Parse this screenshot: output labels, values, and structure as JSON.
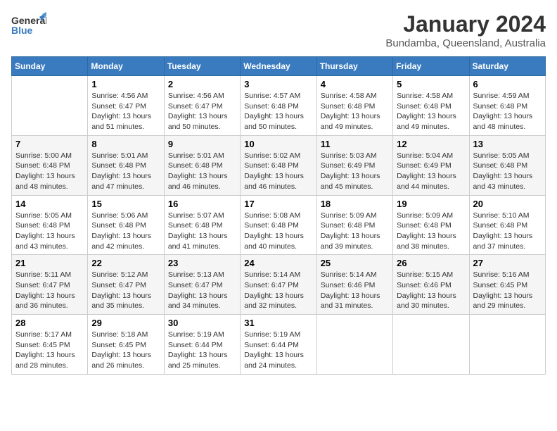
{
  "header": {
    "logo_general": "General",
    "logo_blue": "Blue",
    "title": "January 2024",
    "subtitle": "Bundamba, Queensland, Australia"
  },
  "weekdays": [
    "Sunday",
    "Monday",
    "Tuesday",
    "Wednesday",
    "Thursday",
    "Friday",
    "Saturday"
  ],
  "weeks": [
    [
      {
        "day": "",
        "sunrise": "",
        "sunset": "",
        "daylight": ""
      },
      {
        "day": "1",
        "sunrise": "Sunrise: 4:56 AM",
        "sunset": "Sunset: 6:47 PM",
        "daylight": "Daylight: 13 hours and 51 minutes."
      },
      {
        "day": "2",
        "sunrise": "Sunrise: 4:56 AM",
        "sunset": "Sunset: 6:47 PM",
        "daylight": "Daylight: 13 hours and 50 minutes."
      },
      {
        "day": "3",
        "sunrise": "Sunrise: 4:57 AM",
        "sunset": "Sunset: 6:48 PM",
        "daylight": "Daylight: 13 hours and 50 minutes."
      },
      {
        "day": "4",
        "sunrise": "Sunrise: 4:58 AM",
        "sunset": "Sunset: 6:48 PM",
        "daylight": "Daylight: 13 hours and 49 minutes."
      },
      {
        "day": "5",
        "sunrise": "Sunrise: 4:58 AM",
        "sunset": "Sunset: 6:48 PM",
        "daylight": "Daylight: 13 hours and 49 minutes."
      },
      {
        "day": "6",
        "sunrise": "Sunrise: 4:59 AM",
        "sunset": "Sunset: 6:48 PM",
        "daylight": "Daylight: 13 hours and 48 minutes."
      }
    ],
    [
      {
        "day": "7",
        "sunrise": "Sunrise: 5:00 AM",
        "sunset": "Sunset: 6:48 PM",
        "daylight": "Daylight: 13 hours and 48 minutes."
      },
      {
        "day": "8",
        "sunrise": "Sunrise: 5:01 AM",
        "sunset": "Sunset: 6:48 PM",
        "daylight": "Daylight: 13 hours and 47 minutes."
      },
      {
        "day": "9",
        "sunrise": "Sunrise: 5:01 AM",
        "sunset": "Sunset: 6:48 PM",
        "daylight": "Daylight: 13 hours and 46 minutes."
      },
      {
        "day": "10",
        "sunrise": "Sunrise: 5:02 AM",
        "sunset": "Sunset: 6:48 PM",
        "daylight": "Daylight: 13 hours and 46 minutes."
      },
      {
        "day": "11",
        "sunrise": "Sunrise: 5:03 AM",
        "sunset": "Sunset: 6:49 PM",
        "daylight": "Daylight: 13 hours and 45 minutes."
      },
      {
        "day": "12",
        "sunrise": "Sunrise: 5:04 AM",
        "sunset": "Sunset: 6:49 PM",
        "daylight": "Daylight: 13 hours and 44 minutes."
      },
      {
        "day": "13",
        "sunrise": "Sunrise: 5:05 AM",
        "sunset": "Sunset: 6:48 PM",
        "daylight": "Daylight: 13 hours and 43 minutes."
      }
    ],
    [
      {
        "day": "14",
        "sunrise": "Sunrise: 5:05 AM",
        "sunset": "Sunset: 6:48 PM",
        "daylight": "Daylight: 13 hours and 43 minutes."
      },
      {
        "day": "15",
        "sunrise": "Sunrise: 5:06 AM",
        "sunset": "Sunset: 6:48 PM",
        "daylight": "Daylight: 13 hours and 42 minutes."
      },
      {
        "day": "16",
        "sunrise": "Sunrise: 5:07 AM",
        "sunset": "Sunset: 6:48 PM",
        "daylight": "Daylight: 13 hours and 41 minutes."
      },
      {
        "day": "17",
        "sunrise": "Sunrise: 5:08 AM",
        "sunset": "Sunset: 6:48 PM",
        "daylight": "Daylight: 13 hours and 40 minutes."
      },
      {
        "day": "18",
        "sunrise": "Sunrise: 5:09 AM",
        "sunset": "Sunset: 6:48 PM",
        "daylight": "Daylight: 13 hours and 39 minutes."
      },
      {
        "day": "19",
        "sunrise": "Sunrise: 5:09 AM",
        "sunset": "Sunset: 6:48 PM",
        "daylight": "Daylight: 13 hours and 38 minutes."
      },
      {
        "day": "20",
        "sunrise": "Sunrise: 5:10 AM",
        "sunset": "Sunset: 6:48 PM",
        "daylight": "Daylight: 13 hours and 37 minutes."
      }
    ],
    [
      {
        "day": "21",
        "sunrise": "Sunrise: 5:11 AM",
        "sunset": "Sunset: 6:47 PM",
        "daylight": "Daylight: 13 hours and 36 minutes."
      },
      {
        "day": "22",
        "sunrise": "Sunrise: 5:12 AM",
        "sunset": "Sunset: 6:47 PM",
        "daylight": "Daylight: 13 hours and 35 minutes."
      },
      {
        "day": "23",
        "sunrise": "Sunrise: 5:13 AM",
        "sunset": "Sunset: 6:47 PM",
        "daylight": "Daylight: 13 hours and 34 minutes."
      },
      {
        "day": "24",
        "sunrise": "Sunrise: 5:14 AM",
        "sunset": "Sunset: 6:47 PM",
        "daylight": "Daylight: 13 hours and 32 minutes."
      },
      {
        "day": "25",
        "sunrise": "Sunrise: 5:14 AM",
        "sunset": "Sunset: 6:46 PM",
        "daylight": "Daylight: 13 hours and 31 minutes."
      },
      {
        "day": "26",
        "sunrise": "Sunrise: 5:15 AM",
        "sunset": "Sunset: 6:46 PM",
        "daylight": "Daylight: 13 hours and 30 minutes."
      },
      {
        "day": "27",
        "sunrise": "Sunrise: 5:16 AM",
        "sunset": "Sunset: 6:45 PM",
        "daylight": "Daylight: 13 hours and 29 minutes."
      }
    ],
    [
      {
        "day": "28",
        "sunrise": "Sunrise: 5:17 AM",
        "sunset": "Sunset: 6:45 PM",
        "daylight": "Daylight: 13 hours and 28 minutes."
      },
      {
        "day": "29",
        "sunrise": "Sunrise: 5:18 AM",
        "sunset": "Sunset: 6:45 PM",
        "daylight": "Daylight: 13 hours and 26 minutes."
      },
      {
        "day": "30",
        "sunrise": "Sunrise: 5:19 AM",
        "sunset": "Sunset: 6:44 PM",
        "daylight": "Daylight: 13 hours and 25 minutes."
      },
      {
        "day": "31",
        "sunrise": "Sunrise: 5:19 AM",
        "sunset": "Sunset: 6:44 PM",
        "daylight": "Daylight: 13 hours and 24 minutes."
      },
      {
        "day": "",
        "sunrise": "",
        "sunset": "",
        "daylight": ""
      },
      {
        "day": "",
        "sunrise": "",
        "sunset": "",
        "daylight": ""
      },
      {
        "day": "",
        "sunrise": "",
        "sunset": "",
        "daylight": ""
      }
    ]
  ]
}
